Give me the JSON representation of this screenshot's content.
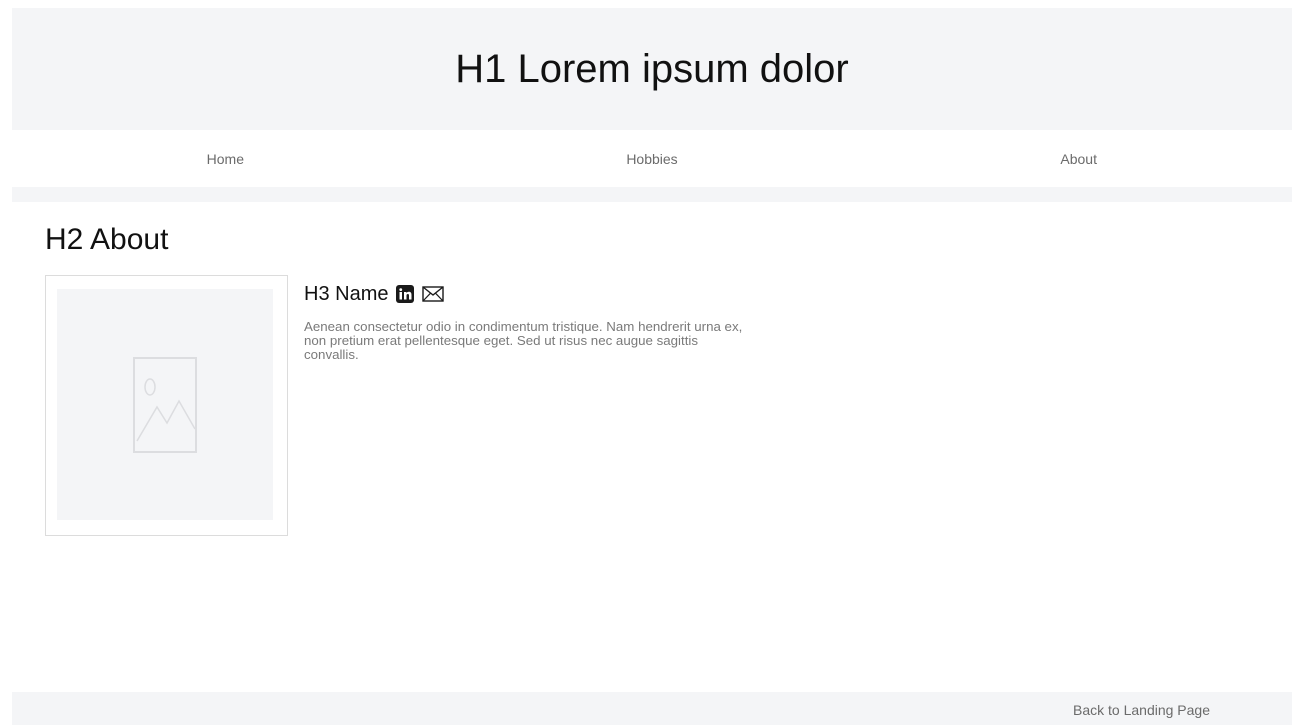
{
  "header": {
    "title": "H1 Lorem ipsum dolor"
  },
  "nav": {
    "items": [
      {
        "label": "Home"
      },
      {
        "label": "Hobbies"
      },
      {
        "label": "About"
      }
    ]
  },
  "main": {
    "section_title": "H2 About",
    "profile": {
      "image_icon": "image-placeholder-icon",
      "name": "H3 Name",
      "social_icons": [
        "linkedin-icon",
        "email-icon"
      ],
      "bio": "Aenean consectetur odio in condimentum tristique. Nam hendrerit urna ex, non pretium erat pellentesque eget. Sed ut risus nec augue sagittis convallis."
    }
  },
  "footer": {
    "link": "Back to Landing Page"
  },
  "colors": {
    "panel_bg": "#f4f5f7",
    "nav_text": "#6b6b6b",
    "body_text": "#7a7a7a"
  }
}
